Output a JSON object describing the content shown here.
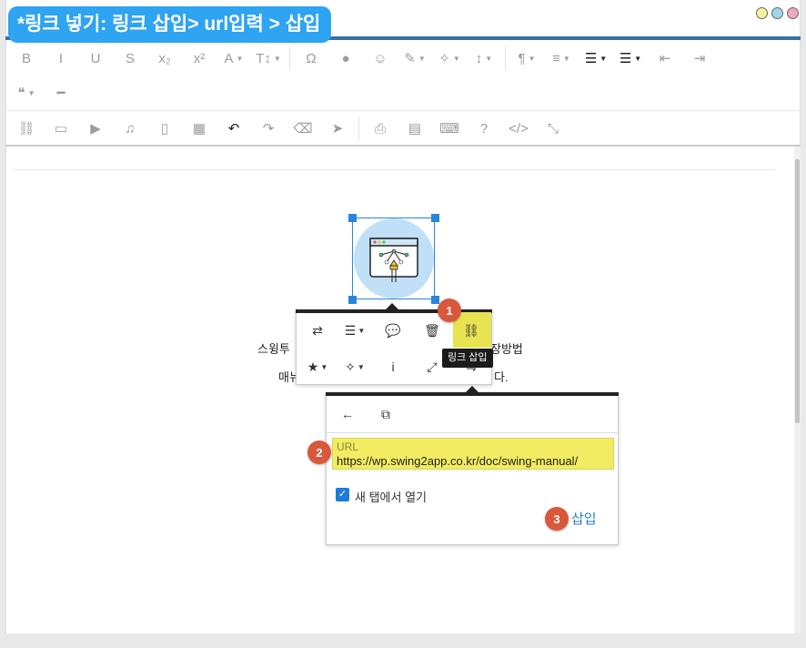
{
  "header": {
    "title_badge": "*링크 넣기: 링크 삽입> url입력 > 삽입",
    "window_dots": [
      "#f6f099",
      "#9fd6ea",
      "#f0a9c4"
    ]
  },
  "toolbar": {
    "row1": [
      {
        "name": "bold-icon",
        "glyph": "B"
      },
      {
        "name": "italic-icon",
        "glyph": "I"
      },
      {
        "name": "underline-icon",
        "glyph": "U"
      },
      {
        "name": "strikethrough-icon",
        "glyph": "S"
      },
      {
        "name": "subscript-icon",
        "glyph": "x₂"
      },
      {
        "name": "superscript-icon",
        "glyph": "x²"
      },
      {
        "name": "font-color-icon",
        "glyph": "A",
        "dropdown": true
      },
      {
        "name": "text-size-icon",
        "glyph": "T↕",
        "dropdown": true
      },
      {
        "name": "special-char-icon",
        "glyph": "Ω"
      },
      {
        "name": "background-color-icon",
        "glyph": "●"
      },
      {
        "name": "emoji-icon",
        "glyph": "☺"
      },
      {
        "name": "paint-brush-icon",
        "glyph": "✎",
        "dropdown": true
      },
      {
        "name": "magic-wand-icon",
        "glyph": "✧",
        "dropdown": true
      },
      {
        "name": "line-height-icon",
        "glyph": "↕",
        "dropdown": true
      },
      {
        "name": "paragraph-icon",
        "glyph": "¶",
        "dropdown": true
      },
      {
        "name": "align-icon",
        "glyph": "≡",
        "dropdown": true
      },
      {
        "name": "ordered-list-icon",
        "glyph": "☰",
        "dropdown": true
      },
      {
        "name": "unordered-list-icon",
        "glyph": "☰",
        "dropdown": true
      },
      {
        "name": "outdent-icon",
        "glyph": "⇤"
      },
      {
        "name": "indent-icon",
        "glyph": "⇥"
      }
    ],
    "row2": [
      {
        "name": "quote-icon",
        "glyph": "❝",
        "dropdown": true
      },
      {
        "name": "horizontal-rule-icon",
        "glyph": "━"
      }
    ],
    "row3": [
      {
        "name": "link-icon",
        "glyph": "⛓"
      },
      {
        "name": "image-icon",
        "glyph": "▭"
      },
      {
        "name": "video-icon",
        "glyph": "▶"
      },
      {
        "name": "audio-icon",
        "glyph": "♫"
      },
      {
        "name": "file-icon",
        "glyph": "▯"
      },
      {
        "name": "table-icon",
        "glyph": "▦"
      },
      {
        "name": "undo-icon",
        "glyph": "↶"
      },
      {
        "name": "redo-icon",
        "glyph": "↷"
      },
      {
        "name": "eraser-icon",
        "glyph": "⌫"
      },
      {
        "name": "select-icon",
        "glyph": "➤"
      },
      {
        "name": "print-icon",
        "glyph": "⎙"
      },
      {
        "name": "pdf-icon",
        "glyph": "▤"
      },
      {
        "name": "keyboard-icon",
        "glyph": "⌨"
      },
      {
        "name": "help-icon",
        "glyph": "?"
      },
      {
        "name": "code-view-icon",
        "glyph": "</>"
      },
      {
        "name": "fullscreen-collapse-icon",
        "glyph": "⤡"
      }
    ]
  },
  "content": {
    "line1_left": "스윙투",
    "line1_right": "장방법",
    "line2_left": "매뉴",
    "line2_right": "다."
  },
  "image_popover": {
    "row1": [
      "⇄",
      "☰",
      "💬",
      "🗑"
    ],
    "row1_names": [
      "swap-icon",
      "align-menu-icon",
      "comment-icon",
      "trash-icon"
    ],
    "row2": [
      "★",
      "✧",
      "i",
      "⤢"
    ],
    "row2_names": [
      "star-icon",
      "wand-icon",
      "info-icon",
      "expand-icon"
    ],
    "link_glyph": "⛓",
    "tooltip": "링크 삽입"
  },
  "link_popover": {
    "back_glyph": "←",
    "open_glyph": "⧉",
    "url_label": "URL",
    "url_value": "https://wp.swing2app.co.kr/doc/swing-manual/",
    "checkbox_label": "새 탭에서 열기",
    "checkbox_checked": true,
    "insert_label": "삽입"
  },
  "badges": [
    "1",
    "2",
    "3"
  ]
}
